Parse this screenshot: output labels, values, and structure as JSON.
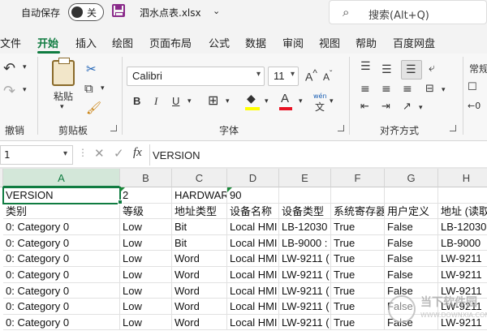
{
  "titlebar": {
    "autosave_label": "自动保存",
    "toggle_state": "关",
    "filename": "泗水点表.xlsx",
    "search_placeholder": "搜索(Alt+Q)"
  },
  "menu": {
    "tabs": [
      "文件",
      "开始",
      "插入",
      "绘图",
      "页面布局",
      "公式",
      "数据",
      "审阅",
      "视图",
      "帮助",
      "百度网盘"
    ],
    "active": "开始"
  },
  "ribbon": {
    "undo_label": "撤销",
    "clipboard_label": "剪贴板",
    "paste_label": "粘贴",
    "font_label": "字体",
    "alignment_label": "对齐方式",
    "number_format": "常规",
    "font_name": "Calibri",
    "font_size": "11",
    "bold": "B",
    "italic": "I",
    "underline": "U",
    "wen": "wén"
  },
  "formula_bar": {
    "name_box": "1",
    "fx": "fx",
    "value": "VERSION"
  },
  "grid": {
    "columns": [
      "A",
      "B",
      "C",
      "D",
      "E",
      "F",
      "G",
      "H"
    ],
    "rows": [
      [
        "VERSION",
        "2",
        "HARDWARE",
        "90",
        "",
        "",
        "",
        ""
      ],
      [
        "类别",
        "等级",
        "地址类型",
        "设备名称",
        "设备类型",
        "系统寄存器",
        "用户定义",
        "地址 (读取)"
      ],
      [
        "0: Category 0",
        "Low",
        "Bit",
        "Local HMI",
        "LB-12030 :",
        "True",
        "False",
        "LB-12030"
      ],
      [
        "0: Category 0",
        "Low",
        "Bit",
        "Local HMI",
        "LB-9000 :",
        "True",
        "False",
        "LB-9000"
      ],
      [
        "0: Category 0",
        "Low",
        "Word",
        "Local HMI",
        "LW-9211 (",
        "True",
        "False",
        "LW-9211"
      ],
      [
        "0: Category 0",
        "Low",
        "Word",
        "Local HMI",
        "LW-9211 (",
        "True",
        "False",
        "LW-9211"
      ],
      [
        "0: Category 0",
        "Low",
        "Word",
        "Local HMI",
        "LW-9211 (",
        "True",
        "False",
        "LW-9211"
      ],
      [
        "0: Category 0",
        "Low",
        "Word",
        "Local HMI",
        "LW-9211 (",
        "True",
        "False",
        "LW-9211"
      ],
      [
        "0: Category 0",
        "Low",
        "Word",
        "Local HMI",
        "LW-9211 (",
        "True",
        "False",
        "LW-9211"
      ]
    ]
  },
  "watermark": {
    "text": "当下软件园",
    "sub": "WWW.DOWNXIA.COM"
  }
}
